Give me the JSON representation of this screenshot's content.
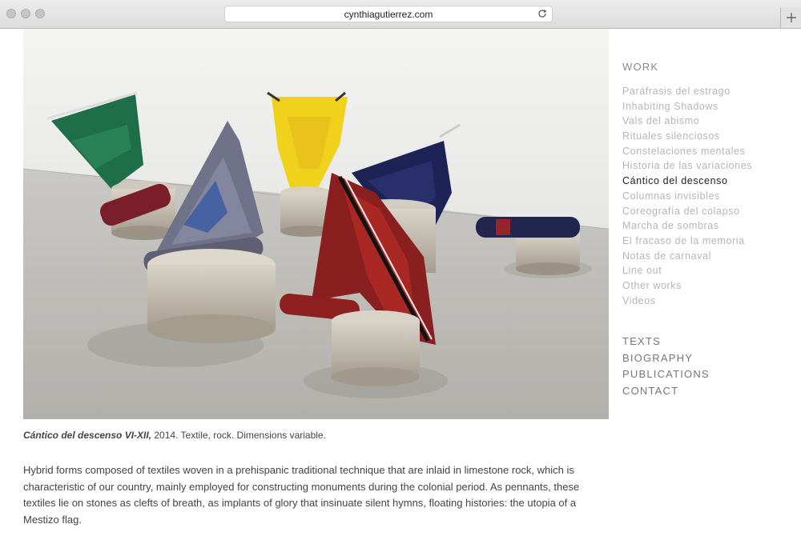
{
  "browser": {
    "url": "cynthiagutierrez.com"
  },
  "photo": {
    "alt_icon": "artwork-photo"
  },
  "caption": {
    "title": "Cántico del descenso VI-XII,",
    "details": " 2014. Textile, rock. Dimensions variable."
  },
  "description": "Hybrid forms composed of textiles woven in a prehispanic traditional technique that are inlaid in limestone rock, which is characteristic of our country, mainly employed for constructing monuments during the colonial period. As pennants, these textiles lie on stones as clefts of breath, as implants of glory that insinuate silent hymns, floating histories: the utopia of a Mestizo flag.",
  "nav": {
    "work_heading": "WORK",
    "work_items": [
      "Paráfrasis del estrago",
      "Inhabiting Shadows",
      "Vals del abismo",
      "Rituales silenciosos",
      "Constelaciones mentales",
      "Historia de las variaciones",
      "Cántico del descenso",
      "Columnas invisibles",
      "Coreografía del colapso",
      "Marcha de sombras",
      "El fracaso de la memoria",
      "Notas de carnaval",
      "Line out",
      "Other works",
      "Videos"
    ],
    "active_index": 6,
    "main_links": [
      "TEXTS",
      "BIOGRAPHY",
      "PUBLICATIONS",
      "CONTACT"
    ]
  },
  "colors": {
    "nav_inactive": "#b5b5b5",
    "nav_active": "#222222",
    "body_text": "#444444"
  }
}
